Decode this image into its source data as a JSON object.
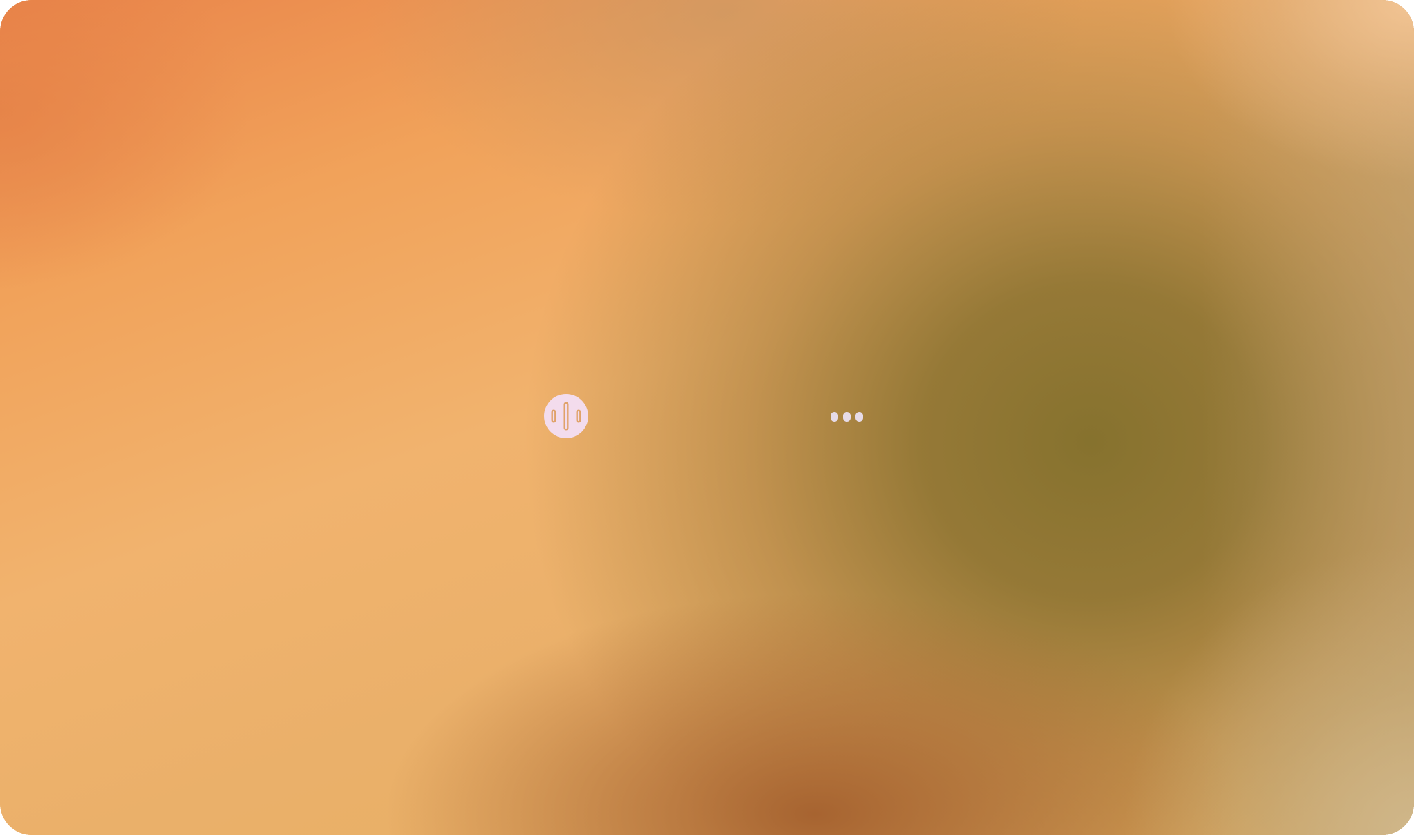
{
  "screen": {
    "colors": {
      "warm_orange": "#f1a25a",
      "olive": "#86722e",
      "rust": "#a4602e",
      "peach": "#f4c696",
      "sand": "#d0b88c"
    }
  },
  "controls": {
    "voice_button": {
      "icon": "voice-waveform-icon",
      "color": "#f3dced",
      "glyph_color": "#e0a26a"
    },
    "more_button": {
      "icon": "more-horizontal-icon",
      "color": "#e6dbe8"
    }
  }
}
